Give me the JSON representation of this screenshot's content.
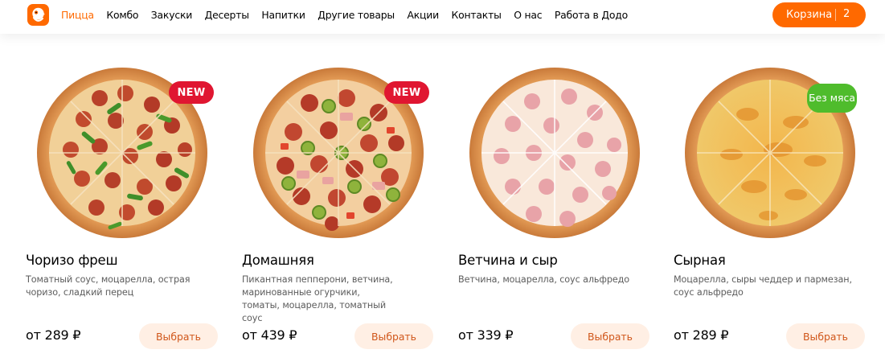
{
  "header": {
    "logo_alt": "Додо Пицца",
    "nav": [
      {
        "label": "Пицца",
        "active": true
      },
      {
        "label": "Комбо"
      },
      {
        "label": "Закуски"
      },
      {
        "label": "Десерты"
      },
      {
        "label": "Напитки"
      },
      {
        "label": "Другие товары"
      },
      {
        "label": "Акции"
      },
      {
        "label": "Контакты"
      },
      {
        "label": "О нас"
      },
      {
        "label": "Работа в Додо"
      }
    ],
    "cart": {
      "label": "Корзина",
      "count": "2"
    }
  },
  "colors": {
    "accent": "#ff6900",
    "badge_new": "#e01631",
    "badge_veg": "#4fbc2c",
    "button_bg": "#ffefe4",
    "button_text": "#d0561a"
  },
  "products": [
    {
      "name": "Чоризо фреш",
      "description": "Томатный соус, моцарелла, острая чоризо, сладкий перец",
      "price": "от 289 ₽",
      "button": "Выбрать",
      "badge": "NEW",
      "image_icon": "pizza-chorizo-image"
    },
    {
      "name": "Домашняя",
      "description": "Пикантная пепперони, ветчина, маринованные огурчики, томаты, моцарелла, томатный соус",
      "price": "от 439 ₽",
      "button": "Выбрать",
      "badge": "NEW",
      "image_icon": "pizza-homestyle-image"
    },
    {
      "name": "Ветчина и сыр",
      "description": "Ветчина, моцарелла, соус альфредо",
      "price": "от 339 ₽",
      "button": "Выбрать",
      "badge": "",
      "image_icon": "pizza-ham-cheese-image"
    },
    {
      "name": "Сырная",
      "description": "Моцарелла, сыры чеддер и пармезан, соус альфредо",
      "price": "от 289 ₽",
      "button": "Выбрать",
      "badge": "Без мяса",
      "image_icon": "pizza-cheese-image"
    }
  ]
}
